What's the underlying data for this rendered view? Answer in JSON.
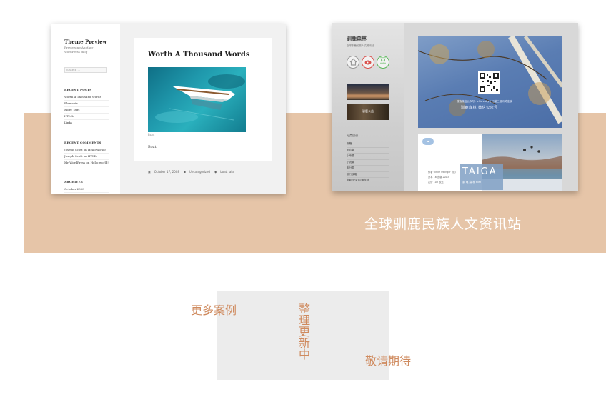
{
  "colors": {
    "band": "#e6c5a8",
    "accent_text": "#cf8a5e",
    "grey_box": "#ececec"
  },
  "showcase_left": {
    "site_title": "Theme Preview",
    "tagline": "Previewing Another WordPress Blog",
    "search_placeholder": "Search ...",
    "recent_posts": {
      "heading": "RECENT POSTS",
      "items": [
        "Worth A Thousand Words",
        "Elements",
        "More Tags",
        "HTML",
        "Links"
      ]
    },
    "recent_comments": {
      "heading": "RECENT COMMENTS",
      "items": [
        "Joseph Scott on Hello world!",
        "Joseph Scott on HTML",
        "Mr WordPress on Hello world!"
      ]
    },
    "archives": {
      "heading": "ARCHIVES",
      "items": [
        "October 2008"
      ]
    },
    "post": {
      "title": "Worth A Thousand Words",
      "caption": "Boat",
      "body": "Boat.",
      "date": "October 17, 2008",
      "category": "Uncategorized",
      "tags": "boat, lake"
    }
  },
  "showcase_right": {
    "site_title": "驯鹿森林",
    "subtitle": "全球驯鹿民族人文资讯站",
    "icons": [
      "home-icon",
      "weibo-icon",
      "douban-icon"
    ],
    "icon_douban_glyph": "豆",
    "banner_text": "驯鹿公益",
    "nav_heading": "分类目录",
    "nav_items": [
      "书籍",
      "图片集",
      "小专题",
      "小说篇",
      "未分类",
      "旅行攻略",
      "电影/纪录片/舞台剧"
    ],
    "qr_line1": "搜索微信公众号：cfforestly  | 扫描二维码关注我",
    "qr_line2": "驯鹿森林 微信公众号",
    "card_lines": [
      "作者  Ulrike Ottinger (德)",
      "开本  16  出版  2013",
      "定价  103 欧元"
    ],
    "taiga_word": "TAIGA",
    "taiga_sub": "泰 嘎 森 林 Film"
  },
  "band_caption": "全球驯鹿民族人文资讯站",
  "more_cases": "更多案例",
  "organizing": "整理更新中",
  "stay_tuned": "敬请期待"
}
